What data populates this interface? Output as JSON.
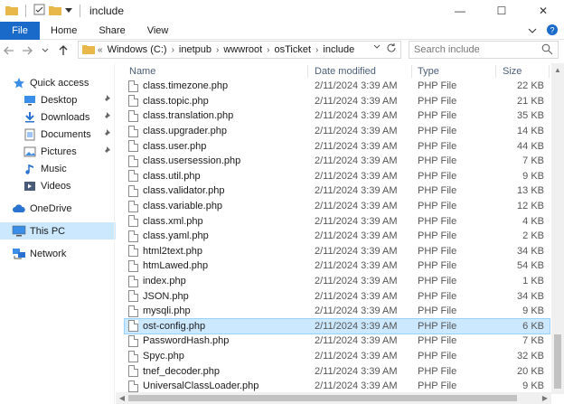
{
  "window": {
    "title": "include",
    "controls": {
      "minimize": "—",
      "maximize": "☐",
      "close": "✕"
    }
  },
  "ribbon": {
    "tabs": [
      "File",
      "Home",
      "Share",
      "View"
    ]
  },
  "address": {
    "crumbs": [
      "Windows (C:)",
      "inetpub",
      "wwwroot",
      "osTicket",
      "include"
    ]
  },
  "search": {
    "placeholder": "Search include"
  },
  "nav": {
    "items": [
      {
        "label": "Quick access",
        "icon": "star-icon",
        "pinned": false
      },
      {
        "label": "Desktop",
        "icon": "desktop-icon",
        "pinned": true
      },
      {
        "label": "Downloads",
        "icon": "downloads-icon",
        "pinned": true
      },
      {
        "label": "Documents",
        "icon": "documents-icon",
        "pinned": true
      },
      {
        "label": "Pictures",
        "icon": "pictures-icon",
        "pinned": true
      },
      {
        "label": "Music",
        "icon": "music-icon",
        "pinned": false
      },
      {
        "label": "Videos",
        "icon": "videos-icon",
        "pinned": false
      },
      {
        "label": "OneDrive",
        "icon": "cloud-icon",
        "pinned": false
      },
      {
        "label": "This PC",
        "icon": "pc-icon",
        "pinned": false,
        "selected": true
      },
      {
        "label": "Network",
        "icon": "network-icon",
        "pinned": false
      }
    ]
  },
  "columns": {
    "name": "Name",
    "date": "Date modified",
    "type": "Type",
    "size": "Size"
  },
  "files": [
    {
      "name": "class.timezone.php",
      "date": "2/11/2024 3:39 AM",
      "type": "PHP File",
      "size": "22 KB"
    },
    {
      "name": "class.topic.php",
      "date": "2/11/2024 3:39 AM",
      "type": "PHP File",
      "size": "21 KB"
    },
    {
      "name": "class.translation.php",
      "date": "2/11/2024 3:39 AM",
      "type": "PHP File",
      "size": "35 KB"
    },
    {
      "name": "class.upgrader.php",
      "date": "2/11/2024 3:39 AM",
      "type": "PHP File",
      "size": "14 KB"
    },
    {
      "name": "class.user.php",
      "date": "2/11/2024 3:39 AM",
      "type": "PHP File",
      "size": "44 KB"
    },
    {
      "name": "class.usersession.php",
      "date": "2/11/2024 3:39 AM",
      "type": "PHP File",
      "size": "7 KB"
    },
    {
      "name": "class.util.php",
      "date": "2/11/2024 3:39 AM",
      "type": "PHP File",
      "size": "9 KB"
    },
    {
      "name": "class.validator.php",
      "date": "2/11/2024 3:39 AM",
      "type": "PHP File",
      "size": "13 KB"
    },
    {
      "name": "class.variable.php",
      "date": "2/11/2024 3:39 AM",
      "type": "PHP File",
      "size": "12 KB"
    },
    {
      "name": "class.xml.php",
      "date": "2/11/2024 3:39 AM",
      "type": "PHP File",
      "size": "4 KB"
    },
    {
      "name": "class.yaml.php",
      "date": "2/11/2024 3:39 AM",
      "type": "PHP File",
      "size": "2 KB"
    },
    {
      "name": "html2text.php",
      "date": "2/11/2024 3:39 AM",
      "type": "PHP File",
      "size": "34 KB"
    },
    {
      "name": "htmLawed.php",
      "date": "2/11/2024 3:39 AM",
      "type": "PHP File",
      "size": "54 KB"
    },
    {
      "name": "index.php",
      "date": "2/11/2024 3:39 AM",
      "type": "PHP File",
      "size": "1 KB"
    },
    {
      "name": "JSON.php",
      "date": "2/11/2024 3:39 AM",
      "type": "PHP File",
      "size": "34 KB"
    },
    {
      "name": "mysqli.php",
      "date": "2/11/2024 3:39 AM",
      "type": "PHP File",
      "size": "9 KB"
    },
    {
      "name": "ost-config.php",
      "date": "2/11/2024 3:39 AM",
      "type": "PHP File",
      "size": "6 KB",
      "selected": true
    },
    {
      "name": "PasswordHash.php",
      "date": "2/11/2024 3:39 AM",
      "type": "PHP File",
      "size": "7 KB"
    },
    {
      "name": "Spyc.php",
      "date": "2/11/2024 3:39 AM",
      "type": "PHP File",
      "size": "32 KB"
    },
    {
      "name": "tnef_decoder.php",
      "date": "2/11/2024 3:39 AM",
      "type": "PHP File",
      "size": "20 KB"
    },
    {
      "name": "UniversalClassLoader.php",
      "date": "2/11/2024 3:39 AM",
      "type": "PHP File",
      "size": "9 KB"
    }
  ],
  "colors": {
    "accent": "#1a6ac9",
    "selection": "#cce8ff",
    "folder": "#e8b84a"
  }
}
